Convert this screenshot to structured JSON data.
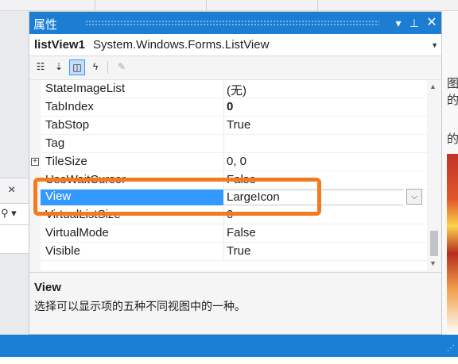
{
  "panel": {
    "title": "属性",
    "pin_icon": "pin-icon",
    "close_icon": "close-icon"
  },
  "object_selector": {
    "name": "listView1",
    "type": "System.Windows.Forms.ListView"
  },
  "toolbar": {
    "buttons": [
      "categorized-icon",
      "alphabetical-icon",
      "properties-icon",
      "events-icon",
      "property-pages-icon"
    ],
    "active": "properties-icon"
  },
  "properties": [
    {
      "name": "StateImageList",
      "value": "(无)"
    },
    {
      "name": "TabIndex",
      "value": "0"
    },
    {
      "name": "TabStop",
      "value": "True"
    },
    {
      "name": "Tag",
      "value": ""
    },
    {
      "name": "TileSize",
      "value": "0, 0"
    },
    {
      "name": "UseWaitCursor",
      "value": "False"
    },
    {
      "name": "View",
      "value": "LargeIcon"
    },
    {
      "name": "VirtualListSize",
      "value": "0"
    },
    {
      "name": "VirtualMode",
      "value": "False"
    },
    {
      "name": "Visible",
      "value": "True"
    }
  ],
  "description": {
    "title": "View",
    "text": "选择可以显示项的五种不同视图中的一种。"
  },
  "background": {
    "right_text_1": "图的",
    "right_text_2": "的"
  },
  "colors": {
    "title_bar": "#1b7ed3",
    "selection": "#3399ff",
    "highlight_box": "#f47a20",
    "status_bar": "#1a7fd5"
  }
}
